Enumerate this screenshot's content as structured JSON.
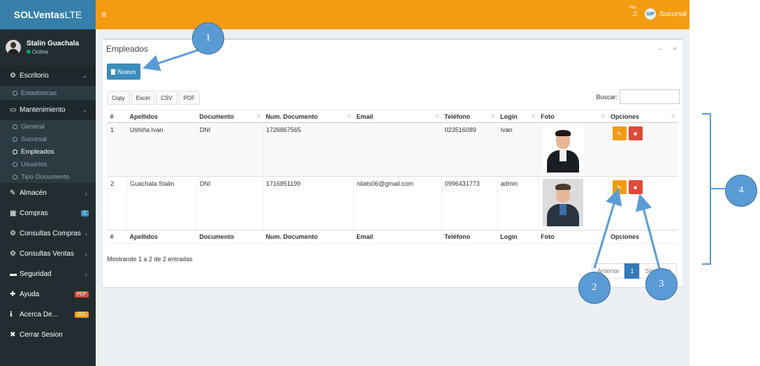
{
  "brand": {
    "bold": "SOLVentas",
    "light": "LTE"
  },
  "user": {
    "name": "Stalin Guachala",
    "status": "Online"
  },
  "sidebar": {
    "items": [
      {
        "icon": "dashboard-icon",
        "glyph": "⚙",
        "label": "Escritorio",
        "caret": "⌄"
      },
      {
        "icon": "laptop-icon",
        "glyph": "▭",
        "label": "Mantenimiento",
        "caret": "⌄"
      },
      {
        "icon": "edit-icon",
        "glyph": "✎",
        "label": "Almacén",
        "caret": "‹"
      },
      {
        "icon": "grid-icon",
        "glyph": "▦",
        "label": "Compras",
        "badge": "C"
      },
      {
        "icon": "settings-icon",
        "glyph": "⚙",
        "label": "Consultas Compras",
        "caret": "‹"
      },
      {
        "icon": "settings-icon",
        "glyph": "⚙",
        "label": "Consultas Ventas",
        "caret": "‹"
      },
      {
        "icon": "folder-icon",
        "glyph": "▬",
        "label": "Seguridad",
        "caret": "‹"
      },
      {
        "icon": "plus-square-icon",
        "glyph": "✚",
        "label": "Ayuda",
        "badge": "PDF"
      },
      {
        "icon": "info-icon",
        "glyph": "ℹ",
        "label": "Acerca De...",
        "badge": "SOL"
      },
      {
        "icon": "close-icon",
        "glyph": "✖",
        "label": "Cerrar Sesion"
      }
    ],
    "escritorio_sub": [
      "Estadísticas"
    ],
    "mantenimiento_sub": [
      "General",
      "Sucursal",
      "Empleados",
      "Usuarios",
      "Tipo Documento"
    ]
  },
  "header": {
    "menu_glyph": "≡",
    "bell_sup": "Hoy",
    "logo_text": "SIP",
    "sucursal": "Sucursal"
  },
  "box": {
    "title": "Empleados",
    "minimize": "–",
    "close": "×",
    "new_button": "Nuevo",
    "exports": [
      "Copy",
      "Excel",
      "CSV",
      "PDF"
    ],
    "search_label": "Buscar:",
    "search_value": ""
  },
  "table": {
    "columns": [
      "#",
      "Apellidos",
      "Documento",
      "Num. Documento",
      "Email",
      "Teléfono",
      "Login",
      "Foto",
      "Opciones"
    ],
    "sort_glyph": "⇅",
    "rows": [
      {
        "num": "1",
        "apellidos": "Ushiña Ivan",
        "documento": "DNI",
        "num_documento": "1726867565",
        "email": "",
        "telefono": "023516089",
        "login": "Ivan"
      },
      {
        "num": "2",
        "apellidos": "Guachala Stalin",
        "documento": "DNI",
        "num_documento": "1716851199",
        "email": "nilats06@gmail.com",
        "telefono": "0996431773",
        "login": "admin"
      }
    ],
    "edit_glyph": "✎",
    "delete_glyph": "■"
  },
  "info": "Mostrando 1 a 2 de 2 entradas",
  "pager": {
    "prev": "Anterior",
    "current": "1",
    "next": "Siguiente"
  },
  "annotations": [
    "1",
    "2",
    "3",
    "4"
  ],
  "colors": {
    "header": "#f39c12",
    "sidebar": "#222d32",
    "brand": "#367fa9",
    "primary": "#3c8dbc",
    "danger": "#dd4b39",
    "annotation": "#5b9bd5"
  }
}
